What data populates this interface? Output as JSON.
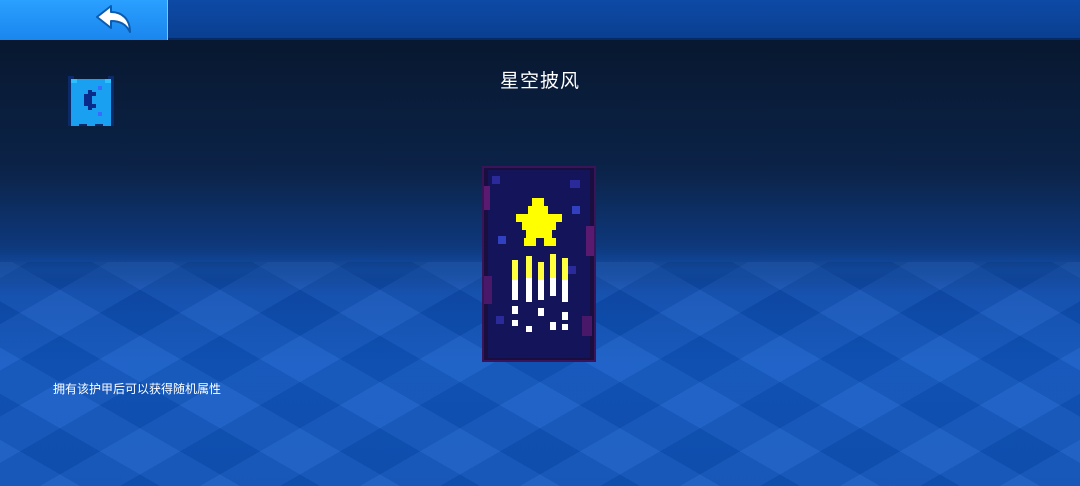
{
  "toolbar": {
    "back_icon": "back-arrow-icon"
  },
  "item": {
    "title": "星空披风",
    "icon": "cape-icon",
    "description": "拥有该护甲后可以获得随机属性"
  },
  "colors": {
    "topbar": "#0a3f90",
    "back_button": "#1a86ee",
    "floor": "#1156bf",
    "star": "#ffff00"
  }
}
